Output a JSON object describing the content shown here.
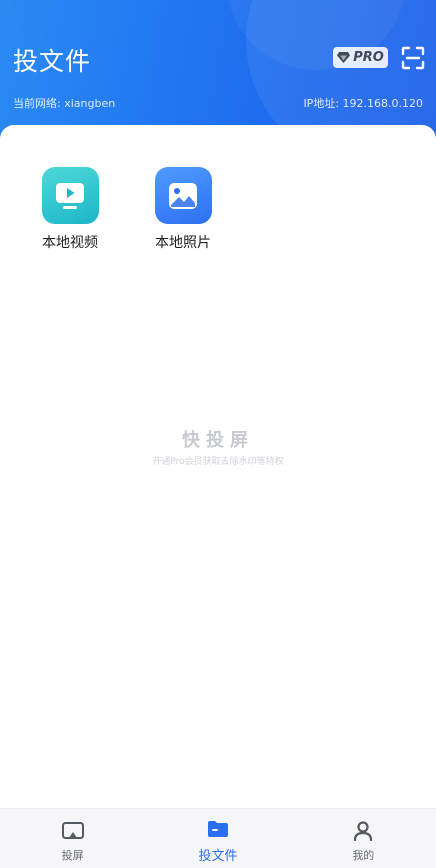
{
  "header": {
    "title": "投文件",
    "pro_label": "PRO",
    "network_label": "当前网络: xiangben",
    "ip_label": "IP地址: 192.168.0.120"
  },
  "tiles": [
    {
      "label": "本地视频",
      "icon": "play-tv-icon"
    },
    {
      "label": "本地照片",
      "icon": "image-icon"
    }
  ],
  "watermark": {
    "title": "快投屏",
    "subtitle": "开通Pro会员获取去除水印等特权"
  },
  "tabbar": {
    "items": [
      {
        "label": "投屏",
        "icon": "cast-screen-icon",
        "active": false
      },
      {
        "label": "投文件",
        "icon": "folder-icon",
        "active": true
      },
      {
        "label": "我的",
        "icon": "person-icon",
        "active": false
      }
    ]
  },
  "colors": {
    "header_start": "#2a8af3",
    "header_end": "#1a5fe8",
    "video_tile": "#1cb6c9",
    "photo_tile": "#2e6ff2",
    "tab_active": "#2a6ff0"
  }
}
